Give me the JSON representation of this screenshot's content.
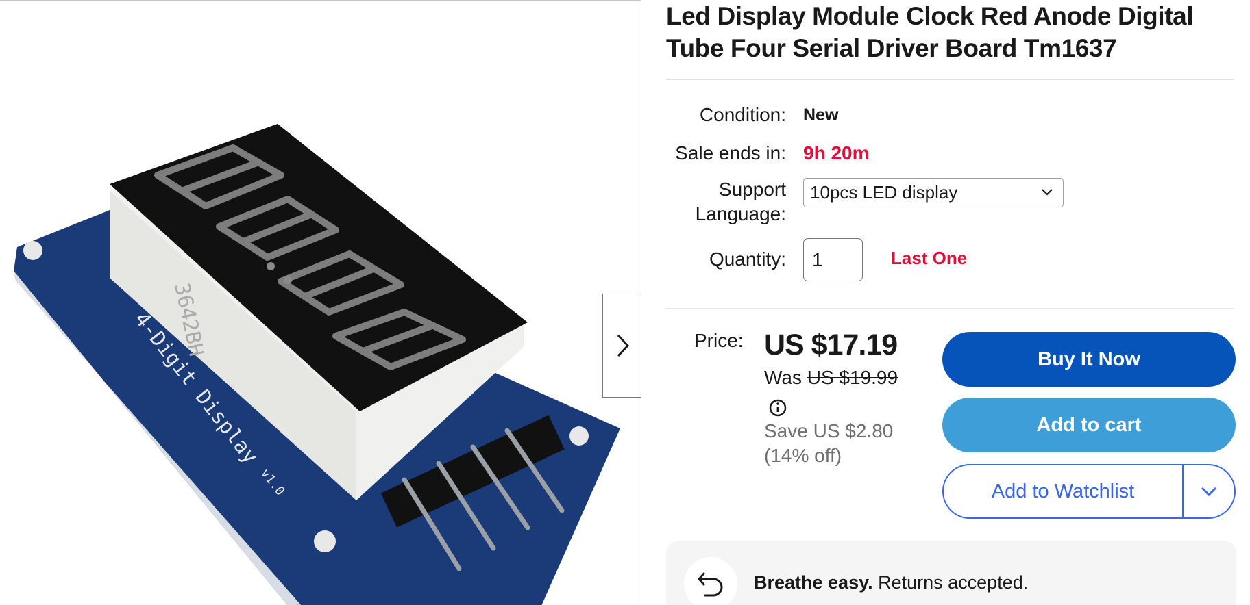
{
  "product": {
    "title": "Led Display Module Clock Red Anode Digital Tube Four Serial Driver Board Tm1637"
  },
  "image": {
    "board_text": "4-Digit Display",
    "board_version": "v1.0",
    "chip_text": "3642BH"
  },
  "details": {
    "condition_label": "Condition:",
    "condition_value": "New",
    "sale_label": "Sale ends in:",
    "sale_value": "9h 20m",
    "support_label_1": "Support",
    "support_label_2": "Language:",
    "support_selected": "10pcs LED display",
    "quantity_label": "Quantity:",
    "quantity_value": "1",
    "stock_note": "Last One"
  },
  "pricing": {
    "price_label": "Price:",
    "price": "US $17.19",
    "was_prefix": "Was",
    "was_price": "US $19.99",
    "save_text": "Save US $2.80 (14% off)"
  },
  "actions": {
    "buy_now": "Buy It Now",
    "add_to_cart": "Add to cart",
    "add_to_watchlist": "Add to Watchlist"
  },
  "returns": {
    "bold": "Breathe easy.",
    "text": " Returns accepted."
  },
  "colors": {
    "buy_button": "#0654ba",
    "cart_button": "#3d9ed8",
    "watch_border": "#3665f3",
    "alert_red": "#e0103a"
  }
}
